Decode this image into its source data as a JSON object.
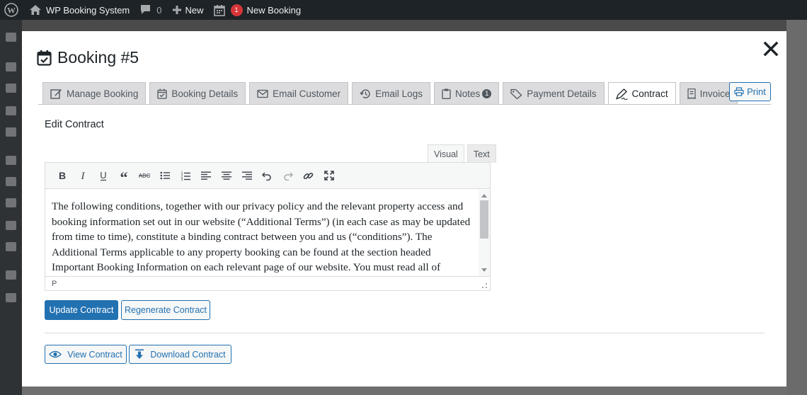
{
  "admin_bar": {
    "site_name": "WP Booking System",
    "comments_count": "0",
    "new_label": "New",
    "notification_count": "1",
    "new_booking_label": "New Booking"
  },
  "modal": {
    "title": "Booking #5",
    "close_icon": "close-icon",
    "tabs": [
      {
        "label": "Manage Booking",
        "icon": "edit-icon"
      },
      {
        "label": "Booking Details",
        "icon": "calendar-check-icon"
      },
      {
        "label": "Email Customer",
        "icon": "envelope-icon"
      },
      {
        "label": "Email Logs",
        "icon": "history-icon"
      },
      {
        "label": "Notes",
        "icon": "clipboard-icon",
        "count": "1"
      },
      {
        "label": "Payment Details",
        "icon": "tag-icon"
      },
      {
        "label": "Contract",
        "icon": "signature-icon",
        "active": true
      },
      {
        "label": "Invoice",
        "icon": "receipt-icon"
      }
    ],
    "print_label": "Print"
  },
  "contract": {
    "section_title": "Edit Contract",
    "editor_tabs": {
      "visual": "Visual",
      "text": "Text"
    },
    "toolbar": [
      "bold",
      "italic",
      "underline",
      "blockquote",
      "strikethrough",
      "bullet-list",
      "numbered-list",
      "align-left",
      "align-center",
      "align-right",
      "undo",
      "redo",
      "link",
      "fullscreen"
    ],
    "content": "The following conditions, together with our privacy policy and the relevant property access and booking information set out in our website (“Additional Terms”) (in each case as may be updated from time to time), constitute a binding contract between you and us (“conditions”). The Additional Terms applicable to any property booking can be found at the section headed Important Booking Information on each relevant page of our website.  You must read all of",
    "status_path": "P",
    "update_label": "Update Contract",
    "regenerate_label": "Regenerate Contract",
    "view_label": "View Contract",
    "download_label": "Download Contract"
  },
  "colors": {
    "admin_bar": "#1d2327",
    "primary": "#2271b1",
    "badge": "#d63638",
    "tab_inactive": "#dcdcde"
  }
}
